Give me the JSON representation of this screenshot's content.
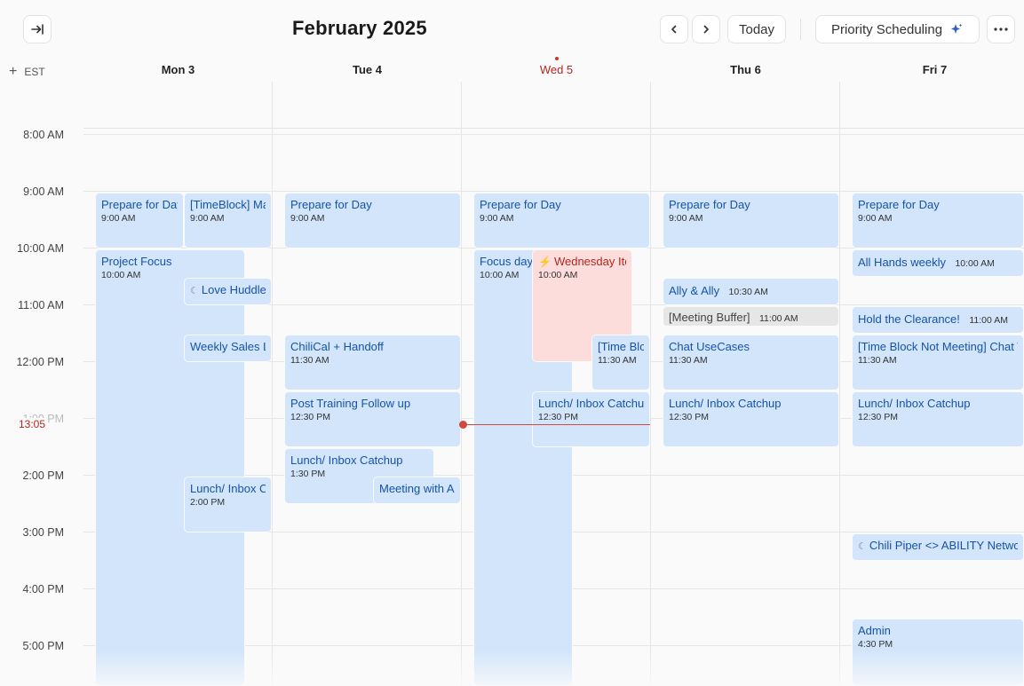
{
  "header": {
    "title": "February 2025",
    "today_label": "Today",
    "priority_label": "Priority Scheduling",
    "timezone": "EST"
  },
  "days": [
    {
      "label": "Mon 3",
      "today": false
    },
    {
      "label": "Tue 4",
      "today": false
    },
    {
      "label": "Wed 5",
      "today": true
    },
    {
      "label": "Thu 6",
      "today": false
    },
    {
      "label": "Fri 7",
      "today": false
    }
  ],
  "hours": [
    "8:00 AM",
    "9:00 AM",
    "10:00 AM",
    "11:00 AM",
    "12:00 PM",
    "1:00 PM",
    "2:00 PM",
    "3:00 PM",
    "4:00 PM",
    "5:00 PM"
  ],
  "now_label": "13:05",
  "events": {
    "mon_prepare": {
      "title": "Prepare for Day",
      "time": "9:00 AM"
    },
    "mon_timeblock": {
      "title": "[TimeBlock] Ma",
      "time": "9:00 AM"
    },
    "mon_project": {
      "title": "Project Focus",
      "time": "10:00 AM"
    },
    "mon_love": {
      "title": "Love Huddle"
    },
    "mon_weekly": {
      "title": "Weekly Sales L"
    },
    "mon_lunch": {
      "title": "Lunch/ Inbox C",
      "time": "2:00 PM"
    },
    "tue_prepare": {
      "title": "Prepare for Day",
      "time": "9:00 AM"
    },
    "tue_chilical": {
      "title": "ChiliCal + Handoff",
      "time": "11:30 AM"
    },
    "tue_post": {
      "title": "Post Training Follow up",
      "time": "12:30 PM"
    },
    "tue_lunch": {
      "title": "Lunch/ Inbox Catchup",
      "time": "1:30 PM"
    },
    "tue_meeting": {
      "title": "Meeting with A"
    },
    "wed_prepare": {
      "title": "Prepare for Day",
      "time": "9:00 AM"
    },
    "wed_focus": {
      "title": "Focus day",
      "time": "10:00 AM"
    },
    "wed_item": {
      "title": "Wednesday Ite",
      "time": "10:00 AM"
    },
    "wed_timeblock": {
      "title": "[Time Blc",
      "time": "11:30 AM"
    },
    "wed_lunch": {
      "title": "Lunch/ Inbox Catchu",
      "time": "12:30 PM"
    },
    "thu_prepare": {
      "title": "Prepare for Day",
      "time": "9:00 AM"
    },
    "thu_ally": {
      "title": "Ally & Ally",
      "time": "10:30 AM"
    },
    "thu_buffer": {
      "title": "[Meeting Buffer]",
      "time": "11:00 AM"
    },
    "thu_chat": {
      "title": "Chat UseCases",
      "time": "11:30 AM"
    },
    "thu_lunch": {
      "title": "Lunch/ Inbox Catchup",
      "time": "12:30 PM"
    },
    "fri_prepare": {
      "title": "Prepare for Day",
      "time": "9:00 AM"
    },
    "fri_allhands": {
      "title": "All Hands weekly",
      "time": "10:00 AM"
    },
    "fri_hold": {
      "title": "Hold the Clearance!",
      "time": "11:00 AM"
    },
    "fri_timeblock": {
      "title": "[Time Block Not Meeting] Chat W",
      "time": "11:30 AM"
    },
    "fri_lunch": {
      "title": "Lunch/ Inbox Catchup",
      "time": "12:30 PM"
    },
    "fri_chili": {
      "title": "Chili Piper <> ABILITY Networ"
    },
    "fri_admin": {
      "title": "Admin",
      "time": "4:30 PM"
    }
  },
  "colors": {
    "event_blue": "#d3e5fb",
    "event_red": "#fddcdc",
    "event_grey": "#e6e6e6",
    "now_red": "#d04a3f"
  }
}
